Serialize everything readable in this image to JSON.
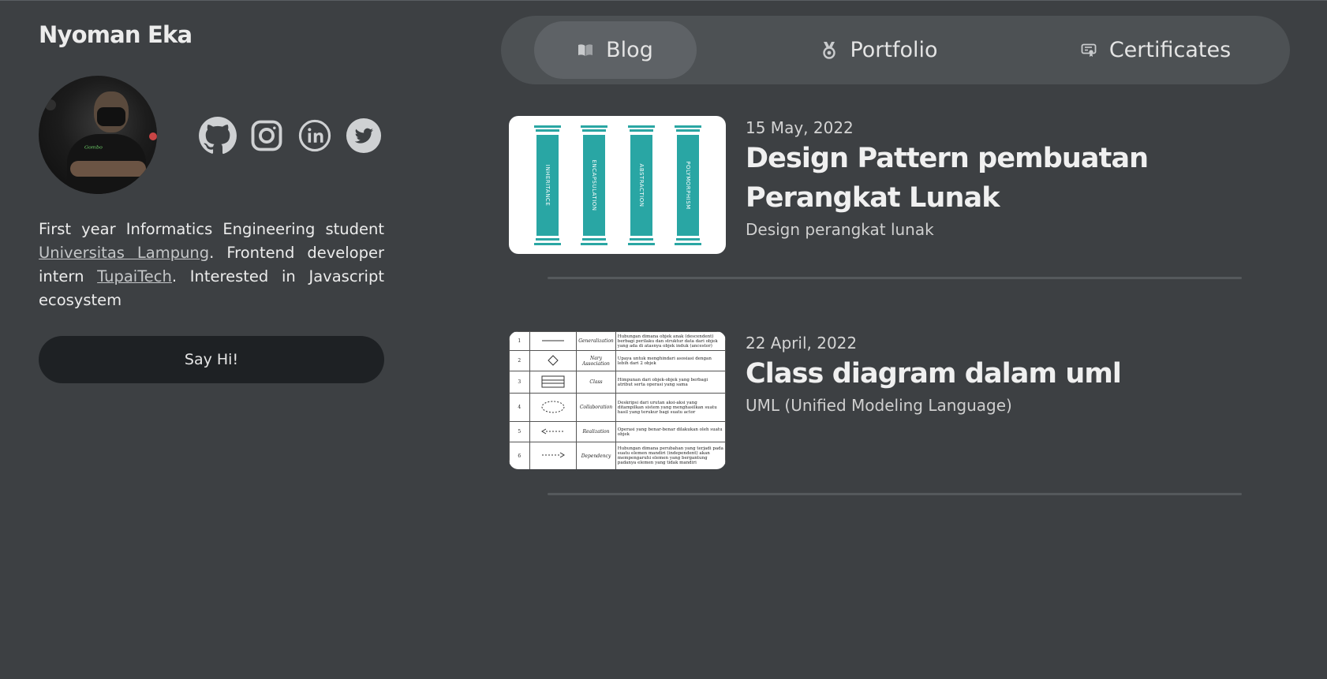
{
  "profile": {
    "name": "Nyoman Eka",
    "bio_intro": "First year Informatics Engineering student ",
    "university": "Universitas Lampung",
    "bio_mid": ". Frontend developer intern ",
    "company": "TupaiTech",
    "bio_end": ". Interested in Javascript ecosystem",
    "say_hi_label": "Say Hi!"
  },
  "socials": [
    {
      "icon": "github-icon"
    },
    {
      "icon": "instagram-icon"
    },
    {
      "icon": "linkedin-icon"
    },
    {
      "icon": "twitter-icon"
    }
  ],
  "nav": {
    "tabs": [
      {
        "label": "Blog",
        "icon": "book-icon",
        "active": true
      },
      {
        "label": "Portfolio",
        "icon": "medal-icon",
        "active": false
      },
      {
        "label": "Certificates",
        "icon": "certificate-icon",
        "active": false
      }
    ]
  },
  "posts": [
    {
      "date": "15 May, 2022",
      "title": "Design Pattern pembuatan Perangkat Lunak",
      "subtitle": "Design perangkat lunak",
      "thumbnail": {
        "pillars": [
          "INHERITANCE",
          "ENCAPSULATION",
          "ABSTRACTION",
          "POLYMORPHISM"
        ]
      }
    },
    {
      "date": "22 April, 2022",
      "title": "Class diagram dalam uml",
      "subtitle": "UML (Unified Modeling Language)",
      "thumbnail": {
        "rows": [
          {
            "no": "1",
            "name": "Generalization",
            "desc": "Hubungan dimana objek anak (descendent) berbagi perilaku dan struktur data dari objek yang ada di atasnya objek induk (ancestor)"
          },
          {
            "no": "2",
            "name": "Nary Association",
            "desc": "Upaya untuk menghindari asosiasi dengan lebih dari 2 objek"
          },
          {
            "no": "3",
            "name": "Class",
            "desc": "Himpunan dari objek-objek yang berbagi atribut serta operasi yang sama"
          },
          {
            "no": "4",
            "name": "Collaboration",
            "desc": "Deskripsi dari urutan aksi-aksi yang ditampilkan sistem yang menghasilkan suatu hasil yang terukur bagi suatu actor"
          },
          {
            "no": "5",
            "name": "Realization",
            "desc": "Operasi yang benar-benar dilakukan oleh suatu objek"
          },
          {
            "no": "6",
            "name": "Dependency",
            "desc": "Hubungan dimana perubahan yang terjadi pada suatu elemen mandiri (independent) akan mempengaruhi elemen yang bergantung padanya elemen yang tidak mandiri"
          }
        ]
      }
    }
  ]
}
